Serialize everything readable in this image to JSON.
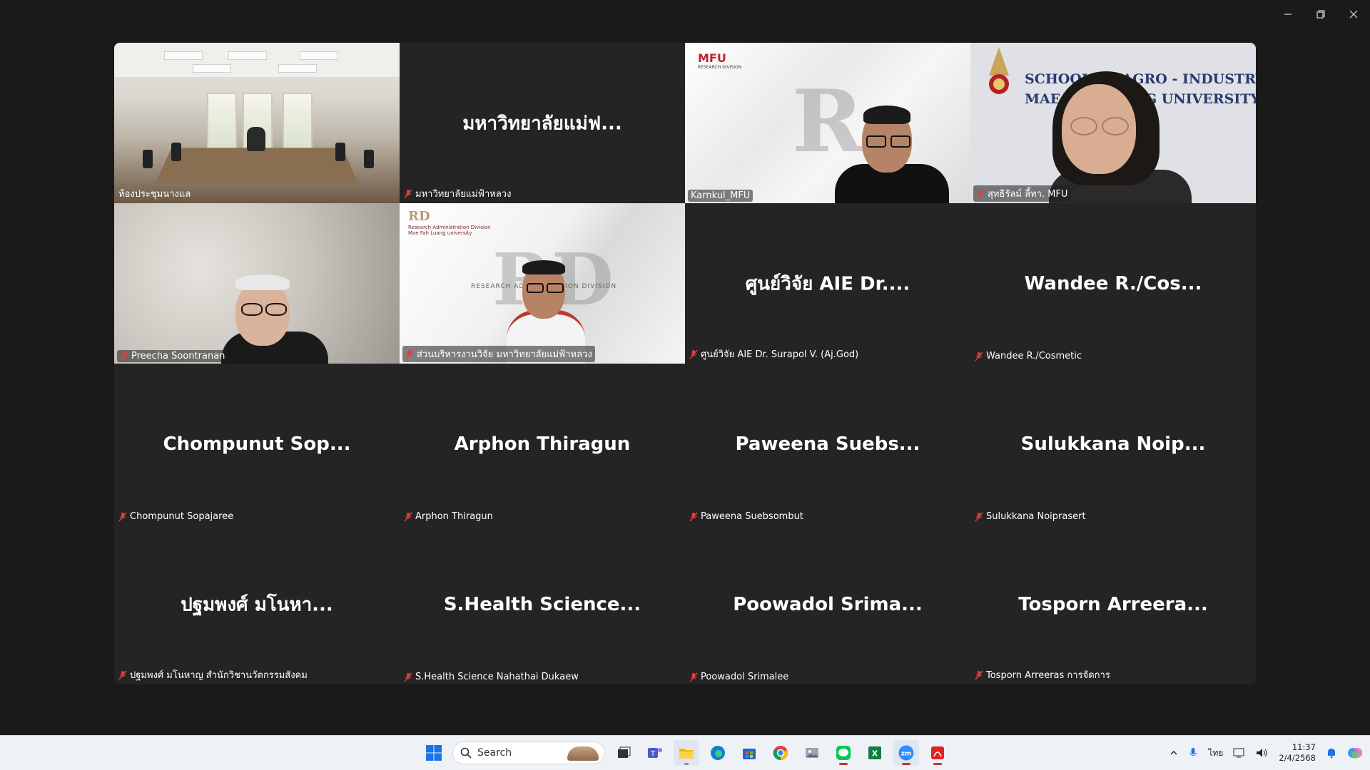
{
  "window_controls": [
    "minimize",
    "restore",
    "close"
  ],
  "active_speaker_color": "#33c46a",
  "tiles": [
    {
      "type": "video",
      "scene": "meeting-room",
      "big_name": "",
      "label": "ห้องประชุมนางแล",
      "muted": false
    },
    {
      "type": "name",
      "big_name": "มหาวิทยาลัยแม่ฟ...",
      "label": "มหาวิทยาลัยแม่ฟ้าหลวง",
      "muted": true
    },
    {
      "type": "video",
      "scene": "mfu-research",
      "big_name": "",
      "label": "Karnkul_MFU",
      "muted": false,
      "logo": "MFU",
      "logo_sub": "RESEARCH DIVISION"
    },
    {
      "type": "video",
      "scene": "school-agro",
      "big_name": "",
      "label": "สุทธิรัลม์ ลี้ทา. MFU",
      "muted": true,
      "banner": [
        "SCHOOL OF AGRO - INDUSTRY",
        "MAE FAH LUANG UNIVERSITY"
      ]
    },
    {
      "type": "video",
      "scene": "blur-office",
      "big_name": "",
      "label": "Preecha Soontranan",
      "muted": true
    },
    {
      "type": "video",
      "scene": "research-admin",
      "big_name": "",
      "label": "ส่วนบริหารงานวิจัย มหาวิทยาลัยแม่ฟ้าหลวง",
      "muted": true,
      "logo_lines": [
        "Research Administration Division",
        "Mae Fah Luang university"
      ],
      "band_text": "RESEARCH ADMINISTRATION DIVISION"
    },
    {
      "type": "name",
      "big_name": "ศูนย์วิจัย AIE Dr....",
      "label": "ศูนย์วิจัย AIE Dr. Surapol V. (Aj.God)",
      "muted": true
    },
    {
      "type": "name",
      "big_name": "Wandee  R./Cos...",
      "label": "Wandee R./Cosmetic",
      "muted": true
    },
    {
      "type": "name",
      "big_name": "Chompunut  Sop...",
      "label": "Chompunut Sopajaree",
      "muted": true
    },
    {
      "type": "name",
      "big_name": "Arphon Thiragun",
      "label": "Arphon Thiragun",
      "muted": true
    },
    {
      "type": "name",
      "big_name": "Paweena  Suebs...",
      "label": "Paweena Suebsombut",
      "muted": true
    },
    {
      "type": "name",
      "big_name": "Sulukkana  Noip...",
      "label": "Sulukkana Noiprasert",
      "muted": true
    },
    {
      "type": "name",
      "big_name": "ปฐมพงศ์ มโนหา...",
      "label": "ปฐมพงศ์ มโนหาญ สำนักวิชานวัตกรรมสังคม",
      "muted": true
    },
    {
      "type": "name",
      "big_name": "S.Health  Science...",
      "label": "S.Health Science Nahathai Dukaew",
      "muted": true
    },
    {
      "type": "name",
      "big_name": "Poowadol  Srima...",
      "label": "Poowadol Srimalee",
      "muted": true
    },
    {
      "type": "name",
      "big_name": "Tosporn  Arreera...",
      "label": "Tosporn Arreeras การจัดการ",
      "muted": true
    }
  ],
  "taskbar": {
    "search_placeholder": "Search",
    "apps": [
      "windows-start",
      "search",
      "task-view",
      "teams",
      "file-explorer",
      "edge",
      "store",
      "chrome",
      "photos",
      "line",
      "excel",
      "zoom",
      "acrobat"
    ],
    "language": "ไทย",
    "time": "11:37",
    "date": "2/4/2568"
  }
}
